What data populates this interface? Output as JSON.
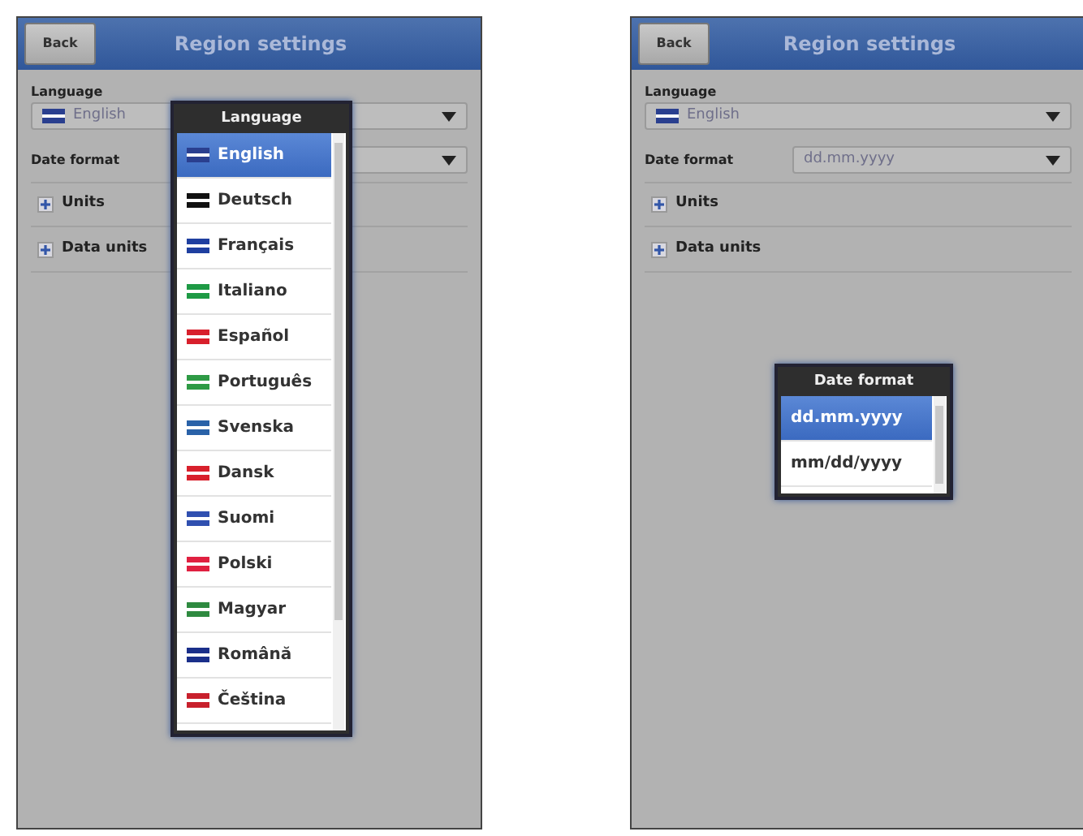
{
  "screens": [
    {
      "header": {
        "back": "Back",
        "title": "Region settings"
      },
      "language": {
        "label": "Language",
        "value": "English",
        "color": "#2a3f8f"
      },
      "date_format": {
        "label": "Date format"
      },
      "sections": [
        {
          "label": "Units",
          "expanded": false
        },
        {
          "label": "Data units",
          "expanded": false
        }
      ],
      "popup": {
        "title": "Language",
        "options": [
          {
            "label": "English",
            "selected": true,
            "color": "#2a3f8f"
          },
          {
            "label": "Deutsch",
            "selected": false,
            "color": "#111111"
          },
          {
            "label": "Français",
            "selected": false,
            "color": "#1f3fa0"
          },
          {
            "label": "Italiano",
            "selected": false,
            "color": "#1e9a45"
          },
          {
            "label": "Español",
            "selected": false,
            "color": "#d8202c"
          },
          {
            "label": "Português",
            "selected": false,
            "color": "#2e9a45"
          },
          {
            "label": "Svenska",
            "selected": false,
            "color": "#2a62a8"
          },
          {
            "label": "Dansk",
            "selected": false,
            "color": "#d8202c"
          },
          {
            "label": "Suomi",
            "selected": false,
            "color": "#3050b0"
          },
          {
            "label": "Polski",
            "selected": false,
            "color": "#e02040"
          },
          {
            "label": "Magyar",
            "selected": false,
            "color": "#2e8a40"
          },
          {
            "label": "Română",
            "selected": false,
            "color": "#1a2f8a"
          },
          {
            "label": "Čeština",
            "selected": false,
            "color": "#c8202c"
          }
        ]
      }
    },
    {
      "header": {
        "back": "Back",
        "title": "Region settings"
      },
      "language": {
        "label": "Language",
        "value": "English",
        "color": "#2a3f8f"
      },
      "date_format": {
        "label": "Date format",
        "value": "dd.mm.yyyy"
      },
      "sections": [
        {
          "label": "Units",
          "expanded": false
        },
        {
          "label": "Data units",
          "expanded": false
        }
      ],
      "popup": {
        "title": "Date format",
        "options": [
          {
            "label": "dd.mm.yyyy",
            "selected": true
          },
          {
            "label": "mm/dd/yyyy",
            "selected": false
          }
        ]
      }
    }
  ]
}
